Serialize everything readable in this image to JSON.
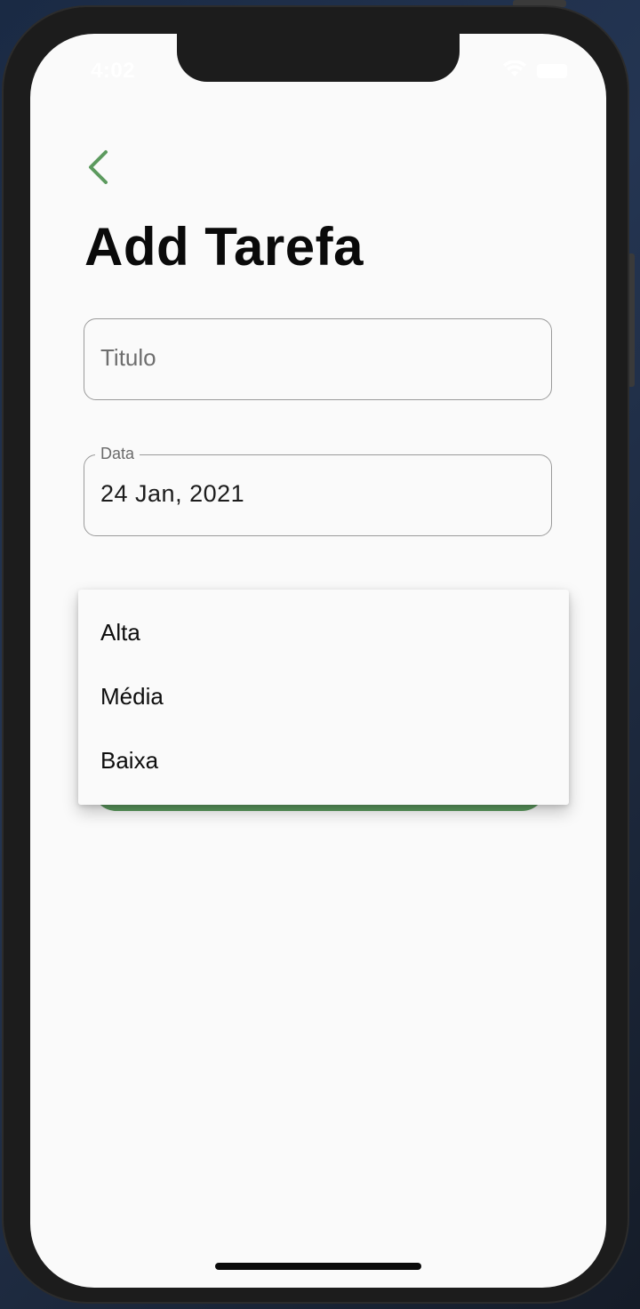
{
  "status_bar": {
    "time": "4:02"
  },
  "header": {
    "title": "Add Tarefa"
  },
  "form": {
    "title_field": {
      "placeholder": "Titulo",
      "value": ""
    },
    "date_field": {
      "label": "Data",
      "value": "24 Jan, 2021"
    }
  },
  "priority_dropdown": {
    "options": [
      "Alta",
      "Média",
      "Baixa"
    ]
  },
  "colors": {
    "accent": "#5c9a5e",
    "background": "#fafafa",
    "text": "#0a0a0a"
  },
  "icons": {
    "back": "chevron-left-icon",
    "wifi": "wifi-icon",
    "battery": "battery-icon"
  }
}
